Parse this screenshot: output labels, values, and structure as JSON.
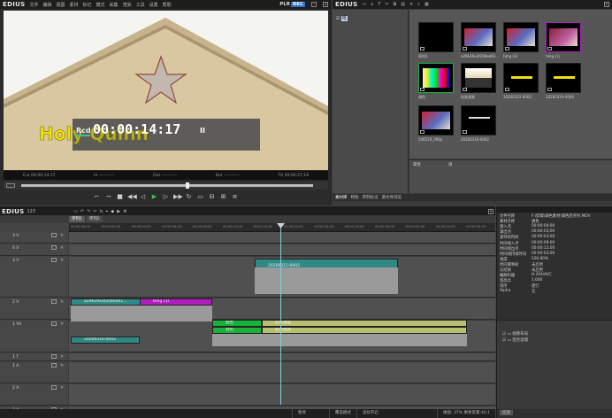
{
  "player": {
    "logo": "EDIUS",
    "menu": [
      "文件",
      "编辑",
      "视图",
      "素材",
      "标记",
      "模式",
      "采集",
      "渲染",
      "工具",
      "设置",
      "帮助"
    ],
    "pl_label": "PLR",
    "rec_label": "REC",
    "timecode_prefix": "Rcd",
    "timecode": "00:00:14:17",
    "pause_symbol": "II",
    "overlay_text": "Holy Quinn",
    "tc_cur_label": "Cur",
    "tc_cur": "00:00:14:17",
    "tc_in_label": "In",
    "tc_in": "--:--:--:--",
    "tc_out_label": "Out",
    "tc_out": "--:--:--:--",
    "tc_dur_label": "Dur",
    "tc_dur": "--:--:--:--",
    "tc_ttl_label": "Ttl",
    "tc_ttl": "00:00:27:16"
  },
  "bin": {
    "logo": "EDIUS",
    "folder_path": "[根目录]",
    "tree_root": "根",
    "props_col1": "属性",
    "props_col2": "值",
    "tabs": [
      "素材库",
      "特效",
      "序列标记",
      "源文件浏览"
    ],
    "clips": [
      {
        "label": "序列1",
        "kind": "black"
      },
      {
        "label": "a29629a3f208ed61...",
        "kind": "photo-red"
      },
      {
        "label": "timg (3)",
        "kind": "photo-red"
      },
      {
        "label": "timg (1)",
        "kind": "photo-magenta"
      },
      {
        "label": "调色",
        "kind": "green-bars"
      },
      {
        "label": "彩条视频",
        "kind": "bars"
      },
      {
        "label": "20200315-0002",
        "kind": "title-yellow"
      },
      {
        "label": "20200316-0000",
        "kind": "title-yellow"
      },
      {
        "label": "546519_000x",
        "kind": "photo-red"
      },
      {
        "label": "20200316-0002",
        "kind": "title-white"
      }
    ]
  },
  "timeline": {
    "logo": "EDIUS",
    "sequence": "123",
    "tabs": [
      "序列1",
      "序列2"
    ],
    "ruler": [
      "00:00:00;00",
      "00:00:02;00",
      "00:00:04;00",
      "00:00:06;00",
      "00:00:08;00",
      "00:00:10;00",
      "00:00:12;00",
      "00:00:14;00",
      "00:00:16;00",
      "00:00:18;00",
      "00:00:20;00",
      "00:00:22;00",
      "00:00:24;00",
      "00:00:26;00"
    ],
    "tracks": [
      {
        "label": "3 V"
      },
      {
        "label": "4 V"
      },
      {
        "label": "3 V"
      },
      {
        "label": "2 V"
      },
      {
        "label": "1 VA"
      },
      {
        "label": "1 T"
      },
      {
        "label": "1 A"
      },
      {
        "label": "2 A"
      },
      {
        "label": "3 A"
      },
      {
        "label": "4 A"
      }
    ],
    "clips": {
      "c_3v": "20200315-0002",
      "c_2v_a": "a29629a3f208ed61...",
      "c_2v_b": "timg (3)",
      "c_1va_a": "调色",
      "c_1va_b": "彩条视频",
      "c_1va_c": "调色",
      "c_1va_d": "彩条视频",
      "c_1t": "20200316-0002"
    },
    "status": {
      "s1": "暂停",
      "s2": "覆盖模式",
      "s3": "波纹开启",
      "s4": "磁盘: 37% 剩余容量:40.1"
    }
  },
  "info": {
    "rows": [
      {
        "k": "文件名称",
        "v": "F:\\剪辑\\调色素材\\调色后序列.MOV"
      },
      {
        "k": "素材名称",
        "v": "调色"
      },
      {
        "k": "源入点",
        "v": "00:00:00;00"
      },
      {
        "k": "源出点",
        "v": "00:00:03;00"
      },
      {
        "k": "源持续时间",
        "v": "00:00:03;00"
      },
      {
        "k": "时间线入点",
        "v": "00:00:09;00"
      },
      {
        "k": "时间线出点",
        "v": "00:00:12;00"
      },
      {
        "k": "时间线持续时间",
        "v": "00:00:03;00"
      },
      {
        "k": "速度",
        "v": "100.00%"
      },
      {
        "k": "时间重映射",
        "v": "未启用"
      },
      {
        "k": "冻结帧",
        "v": "未启用"
      },
      {
        "k": "编解码器",
        "v": "H.264/AVC"
      },
      {
        "k": "宽高比",
        "v": "1.000"
      },
      {
        "k": "场序",
        "v": "逐行"
      },
      {
        "k": "Alpha",
        "v": "无"
      }
    ],
    "fx_items": [
      "视频布局",
      "混合滤镜"
    ],
    "fx_label": "3/3",
    "bottom_tab": "信息"
  },
  "colors": {
    "clip_teal": "#2f8a86",
    "clip_magenta": "#b01cc0",
    "clip_green": "#18b23a",
    "clip_olive": "#b8c070",
    "clip_gray": "#9a9a9a",
    "playhead": "#7fd0e0",
    "overlay_text": "#f0e000"
  }
}
